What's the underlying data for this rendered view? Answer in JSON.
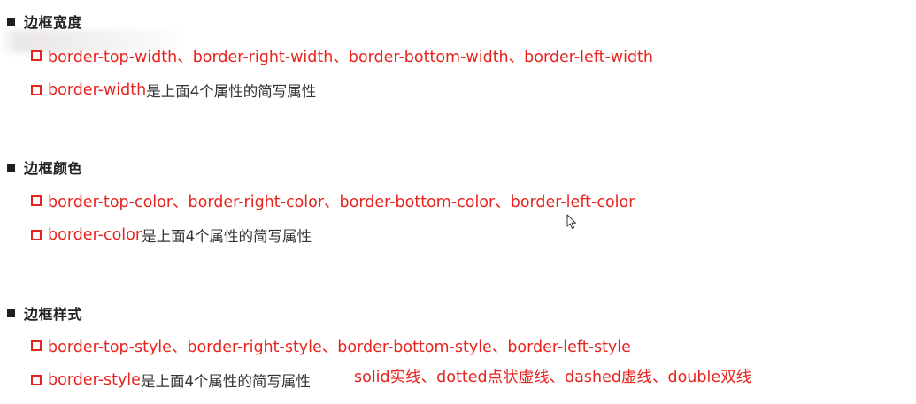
{
  "sections": [
    {
      "heading": "边框宽度",
      "item1": {
        "text": "border-top-width、border-right-width、border-bottom-width、border-left-width"
      },
      "item2": {
        "prop": "border-width",
        "desc": "是上面4个属性的简写属性"
      }
    },
    {
      "heading": "边框颜色",
      "item1": {
        "text": "border-top-color、border-right-color、border-bottom-color、border-left-color"
      },
      "item2": {
        "prop": "border-color",
        "desc": "是上面4个属性的简写属性"
      }
    },
    {
      "heading": "边框样式",
      "item1": {
        "text": "border-top-style、border-right-style、border-bottom-style、border-left-style"
      },
      "item2": {
        "prop": "border-style",
        "desc": "是上面4个属性的简写属性"
      },
      "note": "solid实线、dotted点状虚线、dashed虚线、double双线"
    }
  ],
  "colors": {
    "accent_red": "#e8231d",
    "heading_text": "#222222",
    "body_text": "#333333",
    "background": "#ffffff"
  },
  "icons": {
    "heading_bullet": "black-square-bullet-icon",
    "item_bullet": "red-hollow-square-bullet-icon",
    "cursor": "mouse-pointer-icon"
  }
}
